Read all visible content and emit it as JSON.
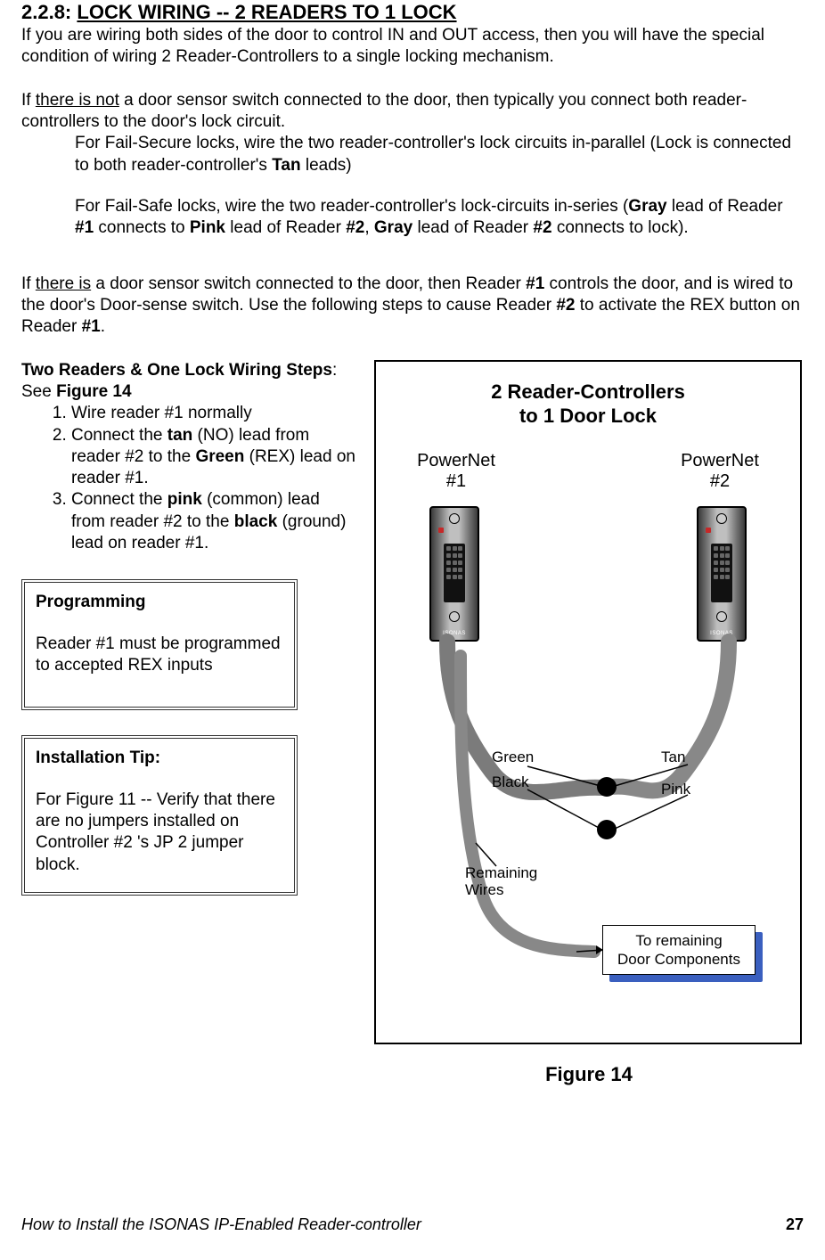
{
  "section": {
    "number": "2.2.8:",
    "title": "LOCK WIRING -- 2 READERS TO 1 LOCK"
  },
  "intro": "If you are wiring both sides of the door to control IN and OUT access, then you will have the special condition of wiring 2 Reader-Controllers to a single locking mechanism.",
  "no_sensor": {
    "lead_in_a": "If ",
    "lead_in_u": "there is not",
    "lead_in_b": " a door sensor switch connected to the door, then typically you connect both reader-controllers to the door's lock circuit.",
    "fail_secure_a": "For Fail-Secure locks, wire the two reader-controller's lock circuits in-parallel (Lock is connected to both reader-controller's ",
    "fail_secure_b": "Tan",
    "fail_secure_c": " leads)",
    "fail_safe_a": "For Fail-Safe locks, wire the two reader-controller's lock-circuits in-series (",
    "fail_safe_b": "Gray",
    "fail_safe_c": " lead of Reader ",
    "fail_safe_d": "#1",
    "fail_safe_e": " connects to ",
    "fail_safe_f": "Pink",
    "fail_safe_g": " lead of Reader ",
    "fail_safe_h": "#2",
    "fail_safe_i": ", ",
    "fail_safe_j": "Gray",
    "fail_safe_k": " lead of Reader ",
    "fail_safe_l": "#2",
    "fail_safe_m": " connects to lock)."
  },
  "with_sensor": {
    "a": "If ",
    "u": "there is",
    "b": " a door sensor switch connected to the door, then Reader ",
    "c": "#1",
    "d": " controls the door, and is wired to the door's Door-sense switch.  Use the following steps to cause Reader ",
    "e": "#2",
    "f": " to activate the REX button on Reader ",
    "g": "#1",
    "h": "."
  },
  "steps": {
    "heading_a": "Two Readers & One Lock Wiring Steps",
    "heading_b": ":   See ",
    "heading_c": "Figure 14",
    "item1": "Wire reader #1 normally",
    "item2_a": "Connect the ",
    "item2_b": "tan",
    "item2_c": " (NO) lead from reader #2 to the ",
    "item2_d": "Green",
    "item2_e": " (REX) lead on reader #1.",
    "item3_a": "Connect the ",
    "item3_b": "pink",
    "item3_c": " (common) lead from reader #2 to the ",
    "item3_d": "black",
    "item3_e": " (ground) lead on reader #1."
  },
  "box_prog": {
    "title": "Programming",
    "body": "Reader #1 must be programmed to accepted REX inputs"
  },
  "box_tip": {
    "title": "Installation Tip:",
    "body": "For Figure 11 -- Verify that there are no jumpers installed on Controller #2 's JP 2 jumper block."
  },
  "figure": {
    "title_l1": "2 Reader-Controllers",
    "title_l2": "to 1 Door Lock",
    "label_pn1_a": "PowerNet",
    "label_pn1_b": "#1",
    "label_pn2_a": "PowerNet",
    "label_pn2_b": "#2",
    "wire_green": "Green",
    "wire_black": "Black",
    "wire_tan": "Tan",
    "wire_pink": "Pink",
    "remaining_a": "Remaining",
    "remaining_b": "Wires",
    "callout_a": "To remaining",
    "callout_b": "Door Components",
    "caption": "Figure 14",
    "brand": "ISONAS"
  },
  "footer": {
    "text": "How to Install the ISONAS IP-Enabled Reader-controller",
    "page": "27"
  }
}
